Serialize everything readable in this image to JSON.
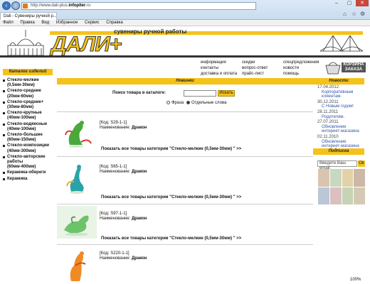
{
  "browser": {
    "url_prefix": "http://www.dali-plus.",
    "url_domain": "infopiter",
    "url_suffix": ".ru",
    "tab_title": "Dali - Сувениры ручной р...",
    "zoom": "100%"
  },
  "menu": [
    "Файл",
    "Правка",
    "Вид",
    "Избранное",
    "Сервис",
    "Справка"
  ],
  "header": {
    "slogan": "сувениры ручной работы",
    "logo": "ДАЛИ+"
  },
  "topnav": {
    "col1": [
      "информация",
      "контакты",
      "доставка и оплата"
    ],
    "col2": [
      "скидки",
      "вопрос-ответ",
      "прайс-лист"
    ],
    "col3": [
      "спецпредложения",
      "новости",
      "помощь"
    ],
    "basket": "КОРЗИНА ЗАКАЗА"
  },
  "left": {
    "heading": "Каталог изделий",
    "items": [
      "Стекло-мелкие (0,5мм-30мм)",
      "Стекло-средние (20мм-60мм)",
      "Стекло-средние+ (30мм-80мм)",
      "Стекло-крупные (40мм-100мм)",
      "Стекло-водяесные (40мм-100мм)",
      "Стекло-большие (60мм-150мм)",
      "Стекло-композиции (40мм-300мм)",
      "Стекло-авторские работы (60мм-400мм)",
      "Керамика-обереги",
      "Керамика"
    ]
  },
  "center": {
    "heading": "Новинки",
    "search_label": "Поиск товара в каталоге:",
    "search_button": "Искать",
    "radio_phrase": "Фраза",
    "radio_words": "Отдельные слова",
    "products": [
      {
        "code": "[Код: S29-1-1]",
        "name_label": "Наименование:",
        "name": "Дракон",
        "link": "Показать все товары категории \"Стекло-мелкие (0,5мм-30мм) \" >>"
      },
      {
        "code": "[Код: S65-1-1]",
        "name_label": "Наименование:",
        "name": "Дракон",
        "link": "Показать все товары категории \"Стекло-мелкие (0,5мм-30мм) \" >>"
      },
      {
        "code": "[Код: S97-1-1]",
        "name_label": "Наименование:",
        "name": "Дракон",
        "link": "Показать все товары категории \"Стекло-мелкие (0,5мм-30мм) \" >>"
      },
      {
        "code": "[Код: S220-1-1]",
        "name_label": "Наименование:",
        "name": "Дракон",
        "link": ""
      }
    ]
  },
  "right": {
    "news_heading": "Новости",
    "news": [
      {
        "date": "17.04.2012",
        "text": "Корпоративным клиентам."
      },
      {
        "date": "30.12.2011",
        "text": "С Новым годом!"
      },
      {
        "date": "28.11.2011",
        "text": "Родителям."
      },
      {
        "date": "27.07.2011",
        "text": "Обновление интернет-магазина"
      },
      {
        "date": "02.11.2010",
        "text": "Обновление интернет-магазина"
      }
    ],
    "subscribe_heading": "Подписка",
    "email_placeholder": "Введите Ваш email:",
    "ok": "Ok"
  }
}
